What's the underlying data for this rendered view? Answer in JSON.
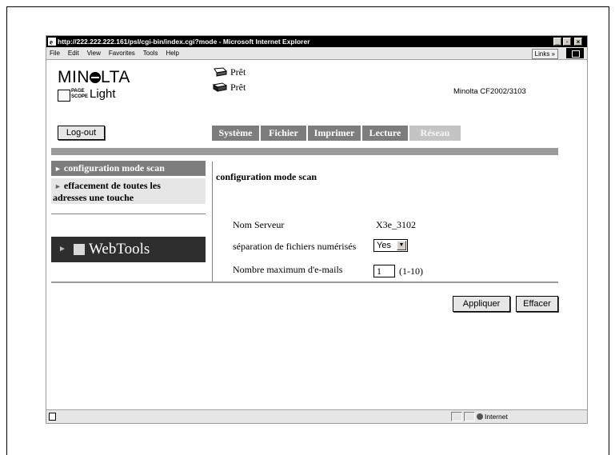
{
  "browser": {
    "title": "http://222.222.222.161/psl/cgi-bin/index.cgi?mode - Microsoft Internet Explorer",
    "menu": [
      "File",
      "Edit",
      "View",
      "Favorites",
      "Tools",
      "Help"
    ],
    "links_label": "Links »",
    "window_buttons": [
      "_",
      "▫",
      "×"
    ],
    "status_zone": "Internet"
  },
  "header": {
    "brand": "MINOLTA",
    "product_small": [
      "PAGE",
      "SCOPE"
    ],
    "product_light": "Light",
    "status": [
      "Prêt",
      "Prêt"
    ],
    "model": "Minolta CF2002/3103",
    "logout_label": "Log-out"
  },
  "tabs": [
    {
      "label": "Système"
    },
    {
      "label": "Fichier"
    },
    {
      "label": "Imprimer"
    },
    {
      "label": "Lecture"
    },
    {
      "label": "Réseau",
      "active": true
    }
  ],
  "sidebar": {
    "items": [
      {
        "label": "configuration mode scan",
        "selected": true
      },
      {
        "label_line1": "effacement de toutes les",
        "label_line2": "adresses une touche"
      }
    ],
    "webtools": "WebTools"
  },
  "form": {
    "title": "configuration mode scan",
    "rows": [
      {
        "label": "Nom Serveur",
        "value": "X3e_3102"
      },
      {
        "label": "séparation de fichiers numérisés",
        "value": "Yes"
      },
      {
        "label": "Nombre maximum d'e-mails",
        "value": "1",
        "range": "(1-10)"
      }
    ],
    "apply_label": "Appliquer",
    "clear_label": "Effacer"
  }
}
